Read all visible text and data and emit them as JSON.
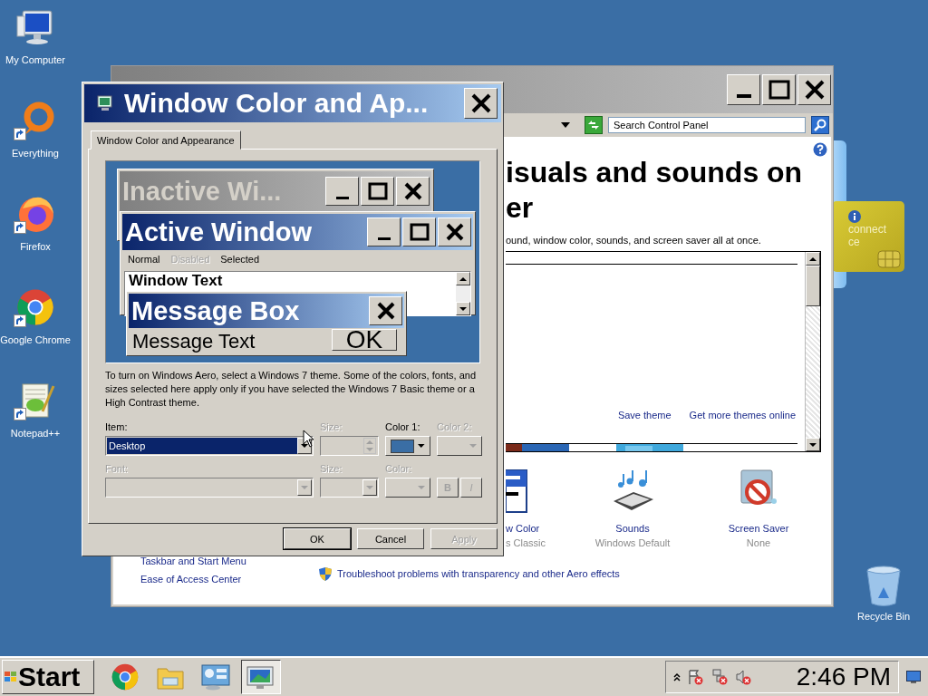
{
  "desktop_icons": [
    {
      "label": "My Computer",
      "kind": "computer",
      "shortcut": false
    },
    {
      "label": "Everything",
      "kind": "everything",
      "shortcut": true
    },
    {
      "label": "Firefox",
      "kind": "firefox",
      "shortcut": true
    },
    {
      "label": "Google Chrome",
      "kind": "chrome",
      "shortcut": true
    },
    {
      "label": "Notepad++",
      "kind": "notepad",
      "shortcut": true
    }
  ],
  "recycle_bin": {
    "label": "Recycle Bin"
  },
  "gadget": {
    "lines": [
      "connect",
      "ce"
    ]
  },
  "control_panel": {
    "search": {
      "placeholder": "Search Control Panel"
    },
    "heading": [
      "isuals and sounds on",
      "er"
    ],
    "subtitle": "ound, window color, sounds, and screen saver all at once.",
    "theme_links": [
      "Save theme",
      "Get more themes online"
    ],
    "settings": [
      {
        "title": "w Color",
        "value": "s Classic",
        "kind": "color"
      },
      {
        "title": "Sounds",
        "value": "Windows Default",
        "kind": "sounds"
      },
      {
        "title": "Screen Saver",
        "value": "None",
        "kind": "screensaver"
      }
    ],
    "see_also": [
      "Taskbar and Start Menu",
      "Ease of Access Center"
    ],
    "troubleshoot": "Troubleshoot problems with transparency and other Aero effects"
  },
  "dialog": {
    "title": "Window Color and Ap...",
    "tab": {
      "label": "Window Color and Appearance",
      "selected": true
    },
    "preview": {
      "inactive_title": "Inactive Wi...",
      "active_title": "Active Window",
      "menu": [
        {
          "label": "Normal",
          "kind": "normal"
        },
        {
          "label": "Disabled",
          "kind": "disabled"
        },
        {
          "label": "Selected",
          "kind": "selected"
        }
      ],
      "window_text": "Window Text",
      "message_title": "Message Box",
      "message_text": "Message Text",
      "ok": "OK"
    },
    "note": "To turn on Windows Aero, select a Windows 7 theme.  Some of the colors, fonts, and sizes selected here apply only if you have selected the Windows 7 Basic theme or a High Contrast theme.",
    "fields": [
      {
        "label": "Item:",
        "kind": "dropdown",
        "value": "Desktop",
        "disabled": false
      },
      {
        "label": "Size:",
        "kind": "spinner",
        "disabled": true
      },
      {
        "label": "Color 1:",
        "kind": "color",
        "color": "#3a6ea5",
        "disabled": false
      },
      {
        "label": "Color 2:",
        "kind": "color",
        "disabled": true
      },
      {
        "label": "Font:",
        "kind": "dropdown",
        "disabled": true
      },
      {
        "label": "Size:",
        "kind": "dropdown",
        "disabled": true
      },
      {
        "label": "Color:",
        "kind": "color",
        "disabled": true
      },
      {
        "kind": "style",
        "buttons": [
          "B",
          "I"
        ],
        "disabled": true
      }
    ],
    "buttons": [
      {
        "label": "OK",
        "disabled": false
      },
      {
        "label": "Cancel",
        "disabled": false
      },
      {
        "label": "Apply",
        "disabled": true
      }
    ]
  },
  "taskbar": {
    "start": "Start",
    "apps": [
      {
        "kind": "chrome",
        "selected": false
      },
      {
        "kind": "folder",
        "selected": false
      },
      {
        "kind": "control-panel",
        "selected": false
      },
      {
        "kind": "display",
        "selected": true
      }
    ],
    "clock": "2:46 PM"
  }
}
